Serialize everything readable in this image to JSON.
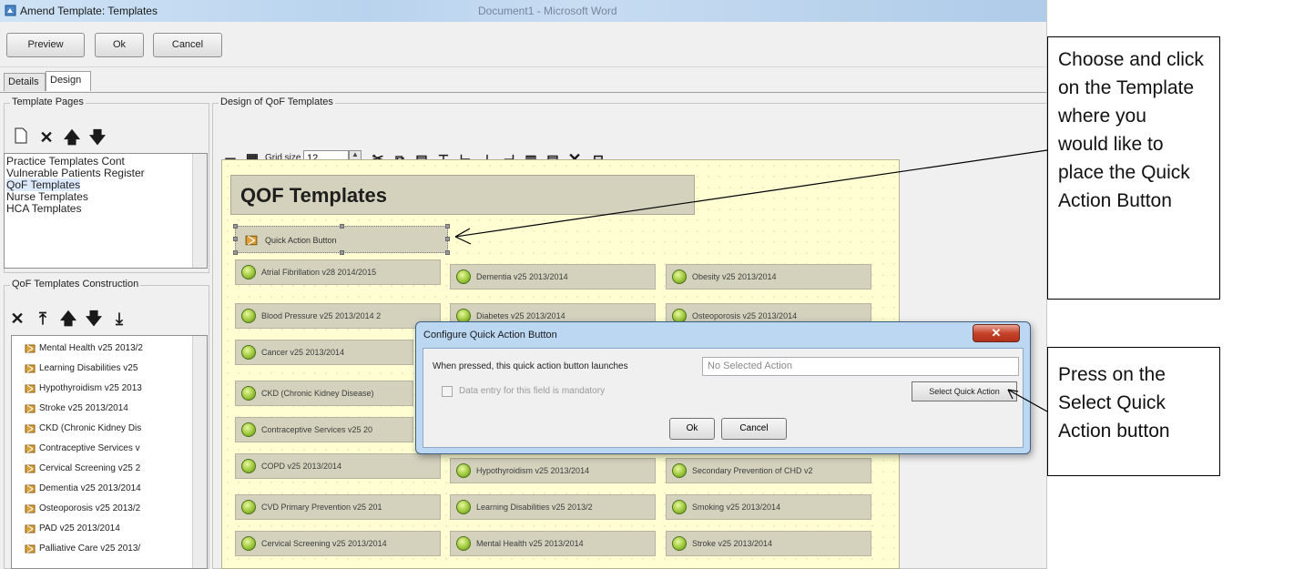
{
  "window": {
    "title": "Amend Template: Templates",
    "title_right": "Document1 - Microsoft Word"
  },
  "toolbar": {
    "preview_label": "Preview",
    "ok_label": "Ok",
    "cancel_label": "Cancel"
  },
  "tabs": [
    "Details",
    "Design"
  ],
  "template_pages": {
    "legend": "Template Pages",
    "items": [
      "Practice Templates Cont",
      "Vulnerable Patients Register",
      "QoF Templates",
      "Nurse Templates",
      "HCA Templates"
    ],
    "selected_index": 2
  },
  "construction": {
    "legend": "QoF Templates Construction",
    "items": [
      "Mental Health v25 2013/2",
      "Learning Disabilities v25",
      "Hypothyroidism v25 2013",
      "Stroke v25 2013/2014",
      "CKD (Chronic Kidney Dis",
      "Contraceptive Services v",
      "Cervical Screening v25 2",
      "Dementia v25 2013/2014",
      "Osteoporosis v25 2013/2",
      "PAD v25 2013/2014",
      "Palliative Care v25 2013/"
    ]
  },
  "design": {
    "legend": "Design of QoF Templates",
    "grid_label": "Grid size",
    "grid_value": "12"
  },
  "canvas": {
    "title": "QOF Templates",
    "quick_action_label": "Quick Action Button",
    "buttons": [
      "Atrial Fibrillation v28 2014/2015",
      "Dementia v25 2013/2014",
      "Obesity v25 2013/2014",
      "Blood Pressure v25 2013/2014 2",
      "Diabetes v25 2013/2014",
      "Osteoporosis v25 2013/2014",
      "Cancer v25 2013/2014",
      "CKD (Chronic Kidney Disease)",
      "Contraceptive Services v25 20",
      "COPD v25 2013/2014",
      "Hypothyroidism v25 2013/2014",
      "Secondary Prevention of CHD v2",
      "CVD Primary Prevention v25 201",
      "Learning Disabilities v25 2013/2",
      "Smoking v25 2013/2014",
      "Cervical Screening v25 2013/2014",
      "Mental Health v25 2013/2014",
      "Stroke v25 2013/2014"
    ]
  },
  "dialog": {
    "title": "Configure Quick Action Button",
    "launch_label": "When pressed, this quick action button launches",
    "launch_value": "No Selected Action",
    "mandatory_label": "Data entry for this field is mandatory",
    "select_label": "Select Quick Action",
    "ok_label": "Ok",
    "cancel_label": "Cancel"
  },
  "callouts": {
    "top": [
      "Choose and click",
      "on the Template",
      "where you",
      "would like to",
      "place the Quick",
      "Action Button"
    ],
    "bottom": [
      "Press on the",
      "Select Quick",
      "Action button"
    ]
  },
  "colors": {
    "canvas_bg": "#fefed2",
    "button_bg": "#d4d2bd",
    "dialog_frame": "#bcd7f2",
    "close_red": "#c5432a"
  }
}
